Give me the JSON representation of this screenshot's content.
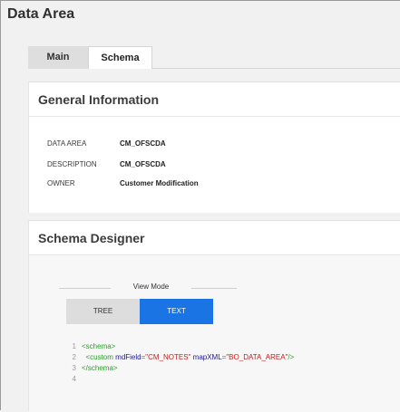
{
  "page": {
    "title": "Data Area"
  },
  "tabs": [
    {
      "label": "Main"
    },
    {
      "label": "Schema"
    }
  ],
  "general": {
    "title": "General Information",
    "fields": [
      {
        "label": "DATA AREA",
        "value": "CM_OFSCDA"
      },
      {
        "label": "DESCRIPTION",
        "value": "CM_OFSCDA"
      },
      {
        "label": "OWNER",
        "value": "Customer Modification"
      }
    ]
  },
  "schema": {
    "title": "Schema Designer",
    "view_mode": {
      "label": "View Mode",
      "options": [
        "TREE",
        "TEXT"
      ],
      "selected": "TEXT"
    },
    "code": {
      "line_numbers": [
        "1",
        "2",
        "3",
        "4"
      ],
      "line1_tag": "<schema>",
      "line2_open": "<custom",
      "line2_attr1": "mdField",
      "line2_val1": "\"CM_NOTES\"",
      "line2_attr2": "mapXML",
      "line2_val2": "\"BO_DATA_AREA\"",
      "line2_close": "/>",
      "line3_tag": "</schema>"
    }
  },
  "colors": {
    "accent": "#1b74e4",
    "tag": "#2a9d2a",
    "string": "#c02020"
  }
}
